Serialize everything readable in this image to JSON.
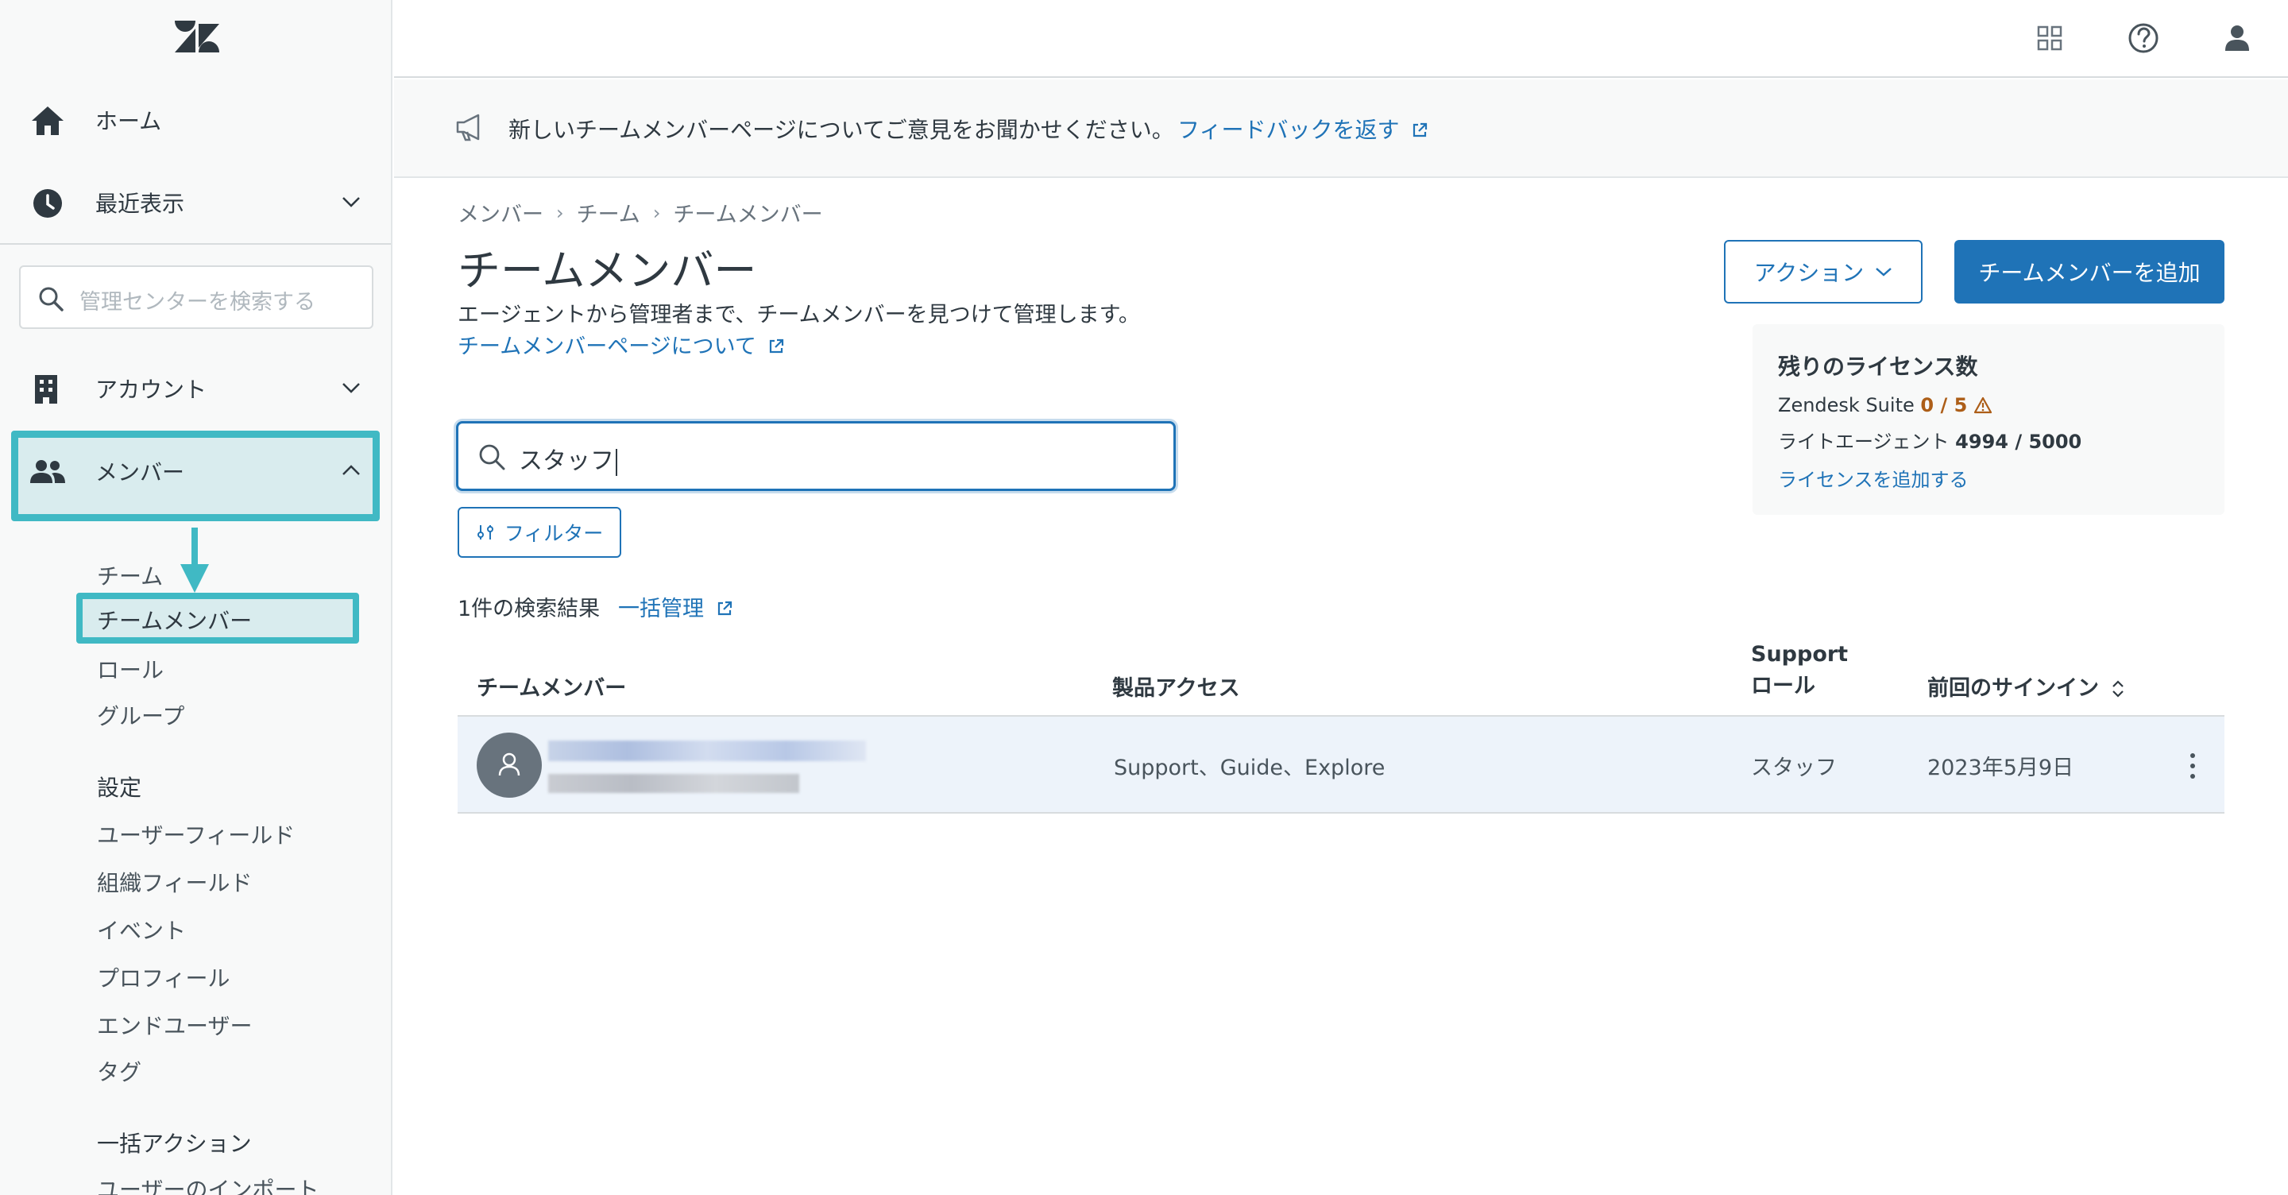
{
  "sidebar": {
    "logo_icon": "zendesk-logo",
    "nav": {
      "home": "ホーム",
      "recent": "最近表示",
      "account": "アカウント",
      "members": "メンバー"
    },
    "search_placeholder": "管理センターを検索する",
    "members_sub": {
      "team": "チーム",
      "team_members": "チームメンバー",
      "roles": "ロール",
      "groups": "グループ"
    },
    "settings": {
      "heading": "設定",
      "items": [
        "ユーザーフィールド",
        "組織フィールド",
        "イベント",
        "プロフィール",
        "エンドユーザー",
        "タグ"
      ]
    },
    "bulk": {
      "heading": "一括アクション",
      "items": [
        "ユーザーのインポート"
      ]
    }
  },
  "topbar": {
    "icons": [
      "products-grid-icon",
      "help-icon",
      "user-profile-icon"
    ]
  },
  "banner": {
    "text": "新しいチームメンバーページについてご意見をお聞かせください。",
    "link": "フィードバックを返す"
  },
  "breadcrumb": [
    "メンバー",
    "チーム",
    "チームメンバー"
  ],
  "page": {
    "title": "チームメンバー",
    "description": "エージェントから管理者まで、チームメンバーを見つけて管理します。",
    "about_link": "チームメンバーページについて"
  },
  "actions": {
    "action_button": "アクション",
    "add_button": "チームメンバーを追加"
  },
  "license": {
    "title": "残りのライセンス数",
    "suite_label": "Zendesk Suite",
    "suite_value": "0 / 5",
    "light_label": "ライトエージェント",
    "light_value": "4994 / 5000",
    "add_link": "ライセンスを追加する"
  },
  "search": {
    "value": "スタッフ"
  },
  "filter_button": "フィルター",
  "results": {
    "count_text": "1件の検索結果",
    "bulk_link": "一括管理"
  },
  "table": {
    "headers": {
      "member": "チームメンバー",
      "product_access": "製品アクセス",
      "support_role": "Supportロール",
      "last_signin": "前回のサインイン"
    },
    "rows": [
      {
        "product_access": "Support、Guide、Explore",
        "support_role": "スタッフ",
        "last_signin": "2023年5月9日"
      }
    ]
  },
  "colors": {
    "accent": "#1f73b7",
    "highlight": "#40b9c4",
    "warning": "#ad5e18"
  }
}
